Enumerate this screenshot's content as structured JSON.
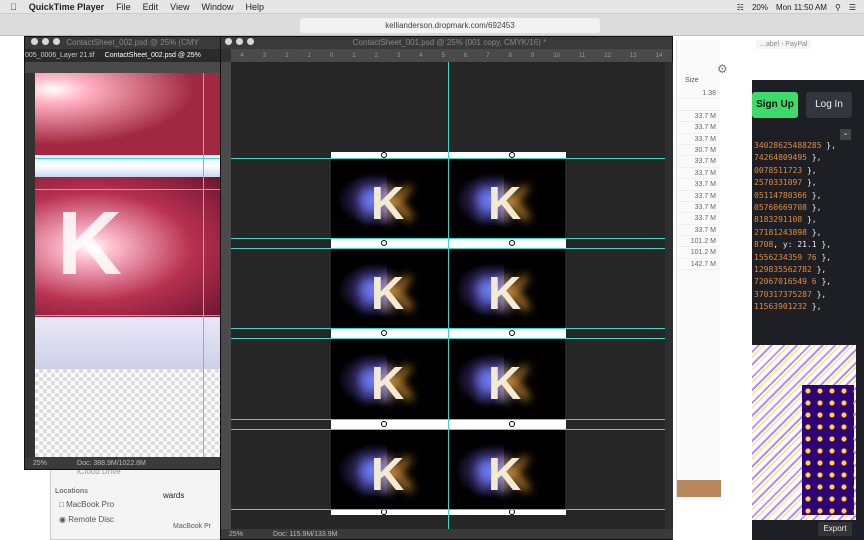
{
  "menubar": {
    "app": "QuickTime Player",
    "items": [
      "File",
      "Edit",
      "View",
      "Window",
      "Help"
    ],
    "battery": "20%",
    "clock": "Mon 11:50 AM"
  },
  "browser": {
    "url": "kellianderson.dropmark.com/692453",
    "tab_right": "...abel - PayPal"
  },
  "left_window": {
    "title": "ContactSheet_002.psd @ 25% (CMY",
    "tabs": [
      "005_0006_Layer 21.tif",
      "ContactSheet_002.psd @ 25%"
    ],
    "zoom": "25%",
    "doc": "Doc: 388.9M/1022.8M"
  },
  "main_window": {
    "title": "ContactSheet_001.psd @ 25% (001 copy, CMYK/16) *",
    "ruler": [
      "4",
      "3",
      "2",
      "1",
      "0",
      "1",
      "2",
      "3",
      "4",
      "5",
      "6",
      "7",
      "8",
      "9",
      "10",
      "11",
      "12",
      "13",
      "14"
    ],
    "zoom": "25%",
    "doc": "Doc: 115.9M/133.9M",
    "letter": "K"
  },
  "finder": {
    "section": "Locations",
    "items": [
      "iCloud Drive",
      "MacBook Pro",
      "Remote Disc"
    ],
    "middle": "wards",
    "path": "MacBook Pr"
  },
  "file_list": {
    "header": "Size",
    "sizes": [
      "1.38",
      "",
      "33.7 M",
      "33.7 M",
      "33.7 M",
      "30.7 M",
      "33.7 M",
      "33.7 M",
      "33.7 M",
      "33.7 M",
      "33.7 M",
      "33.7 M",
      "33.7 M",
      "101.2 M",
      "101.2 M",
      "142.7 M"
    ]
  },
  "side_panel": {
    "sign_up": "Sign Up",
    "log_in": "Log In",
    "export": "Export",
    "code_lines": [
      [
        "34028625488285",
        " },"
      ],
      [
        "74264809495",
        " },"
      ],
      [
        "0078511723",
        " },"
      ],
      [
        "2570331097",
        " },"
      ],
      [
        "05114780366",
        " },"
      ],
      [
        "05760669708",
        " },"
      ],
      [
        "8183291108",
        " },"
      ],
      [
        "27181243898",
        " },"
      ],
      [
        "8708",
        ", y: 21.1 },"
      ],
      [
        "1556234359 76",
        " },"
      ],
      [
        "129835562782",
        " },"
      ],
      [
        "72067016549 6",
        " },"
      ],
      [
        "370317375287",
        " },"
      ],
      [
        "11563901232",
        " },"
      ]
    ]
  },
  "colors": {
    "guide": "#3fd6c8",
    "signup": "#3ddc6a"
  }
}
